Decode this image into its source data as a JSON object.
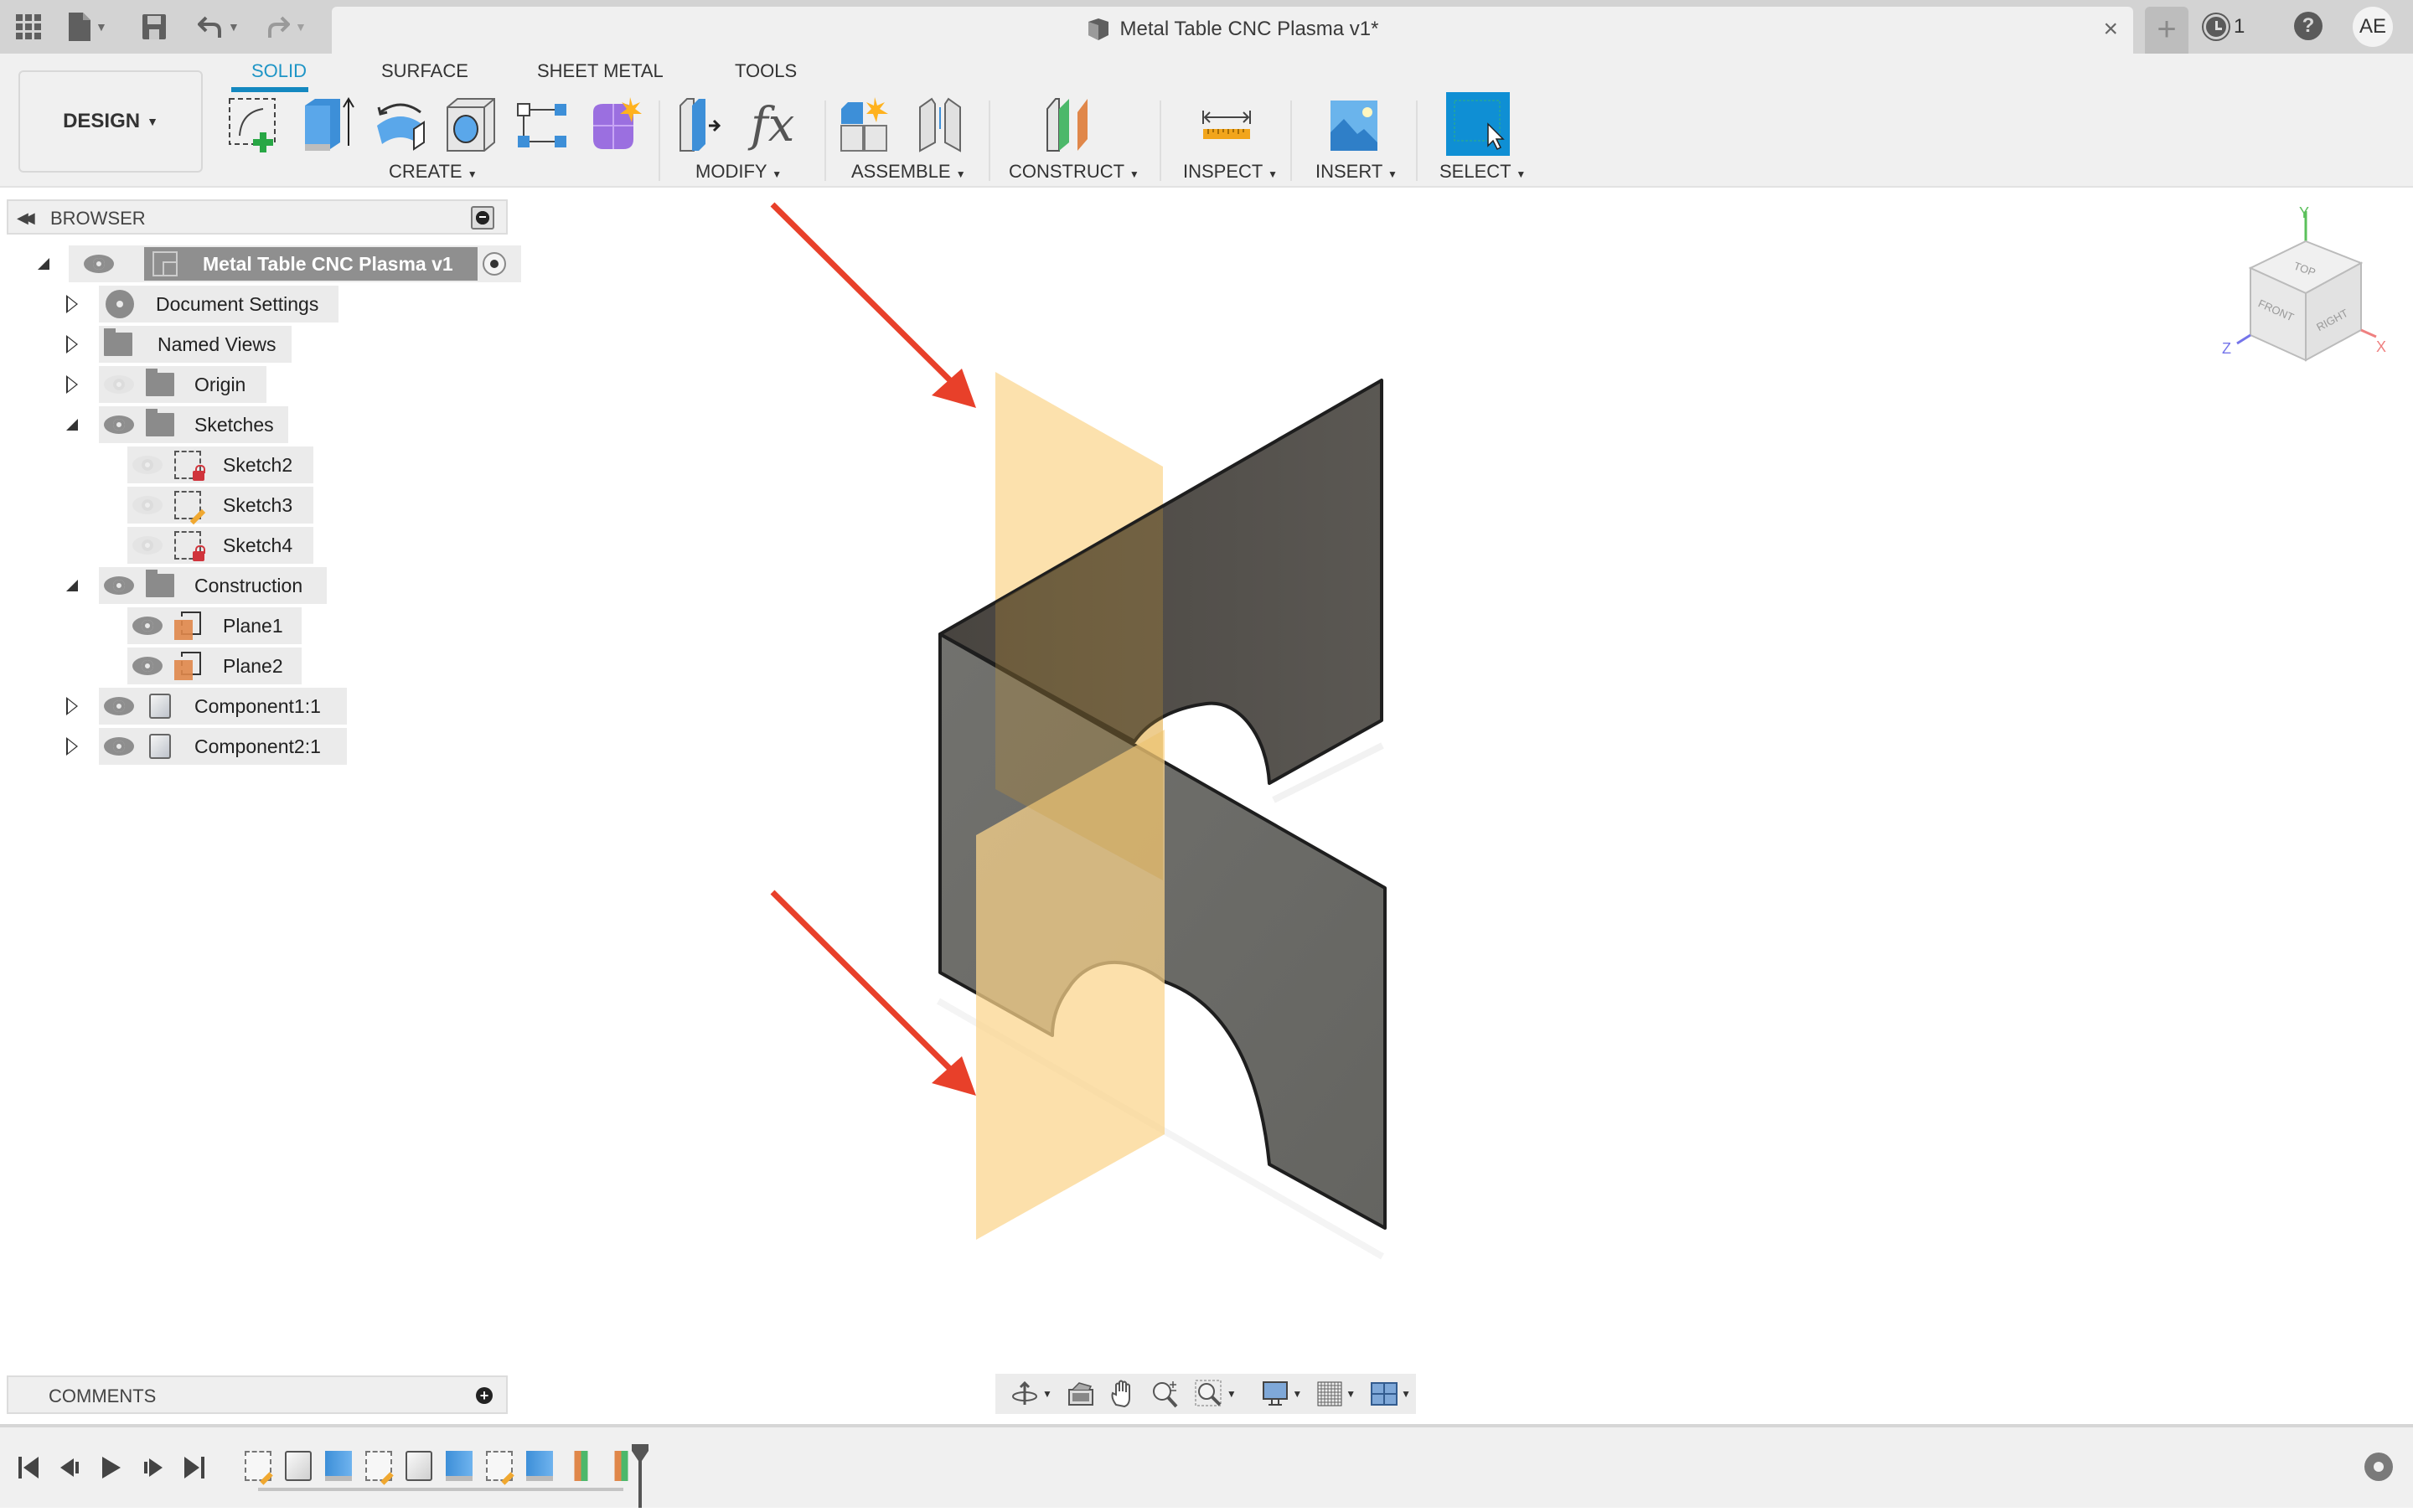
{
  "titlebar": {
    "doc_title": "Metal Table CNC Plasma v1*",
    "close_label": "×",
    "new_tab_label": "+",
    "jobs_count": "1",
    "help_label": "?",
    "user_initials": "AE"
  },
  "ribbon": {
    "workspace_label": "DESIGN",
    "tabs": [
      {
        "label": "SOLID",
        "active": true
      },
      {
        "label": "SURFACE",
        "active": false
      },
      {
        "label": "SHEET METAL",
        "active": false
      },
      {
        "label": "TOOLS",
        "active": false
      }
    ],
    "groups": [
      {
        "label": "CREATE",
        "tools": [
          "create-sketch",
          "extrude",
          "revolve",
          "hole",
          "pattern",
          "create-form"
        ]
      },
      {
        "label": "MODIFY",
        "tools": [
          "press-pull",
          "parameters"
        ]
      },
      {
        "label": "ASSEMBLE",
        "tools": [
          "new-component",
          "joint"
        ]
      },
      {
        "label": "CONSTRUCT",
        "tools": [
          "offset-plane"
        ]
      },
      {
        "label": "INSPECT",
        "tools": [
          "measure"
        ]
      },
      {
        "label": "INSERT",
        "tools": [
          "insert-image"
        ]
      },
      {
        "label": "SELECT",
        "tools": [
          "select"
        ]
      }
    ],
    "fx_label": "fx"
  },
  "browser": {
    "title": "BROWSER",
    "root": {
      "label": "Metal Table CNC Plasma v1"
    },
    "items": [
      {
        "label": "Document Settings",
        "type": "settings",
        "expanded": false,
        "visible": null
      },
      {
        "label": "Named Views",
        "type": "folder",
        "expanded": false,
        "visible": null
      },
      {
        "label": "Origin",
        "type": "folder",
        "expanded": false,
        "visible": false
      },
      {
        "label": "Sketches",
        "type": "folder",
        "expanded": true,
        "visible": true
      },
      {
        "label": "Sketch2",
        "type": "sketch-locked",
        "visible": false
      },
      {
        "label": "Sketch3",
        "type": "sketch-edit",
        "visible": false
      },
      {
        "label": "Sketch4",
        "type": "sketch-locked",
        "visible": false
      },
      {
        "label": "Construction",
        "type": "folder",
        "expanded": true,
        "visible": true
      },
      {
        "label": "Plane1",
        "type": "plane",
        "visible": true
      },
      {
        "label": "Plane2",
        "type": "plane",
        "visible": true
      },
      {
        "label": "Component1:1",
        "type": "component",
        "expanded": false,
        "visible": true
      },
      {
        "label": "Component2:1",
        "type": "component",
        "expanded": false,
        "visible": true
      }
    ]
  },
  "viewcube": {
    "faces": [
      "TOP",
      "FRONT",
      "RIGHT"
    ],
    "axes": [
      "Y",
      "Z",
      "X"
    ]
  },
  "comments": {
    "title": "COMMENTS",
    "add_label": "+"
  },
  "navbar": {
    "tools": [
      "orbit",
      "look-at",
      "pan",
      "zoom",
      "fit",
      "display-settings",
      "grid-snaps",
      "viewports"
    ]
  },
  "timeline": {
    "controls": [
      "first",
      "previous",
      "play",
      "next",
      "last"
    ],
    "features": [
      "sketch",
      "box",
      "extrude",
      "sketch",
      "box",
      "extrude",
      "sketch",
      "extrude",
      "plane",
      "plane"
    ]
  },
  "colors": {
    "accent": "#1488c0",
    "plane": "#fbd48a",
    "body": "#5b5b57",
    "annotation_arrow": "#e8402a",
    "select_tool": "#0f8fd4"
  }
}
